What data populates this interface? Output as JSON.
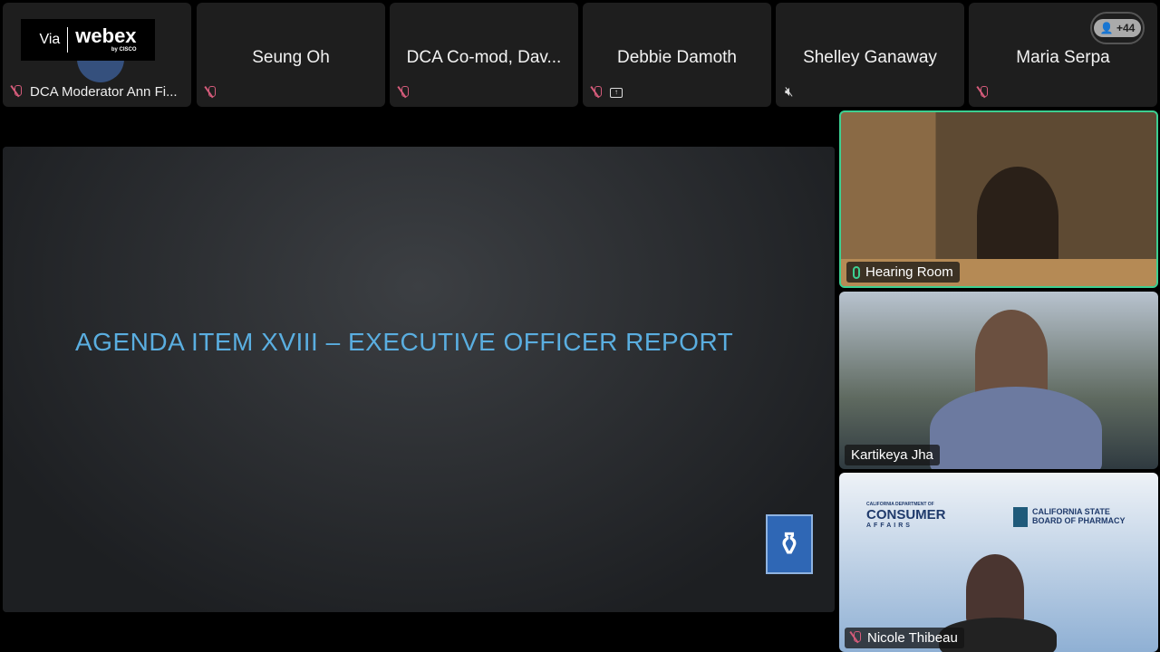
{
  "participants": [
    {
      "name": "DCA Moderator Ann Fi...",
      "muted": true
    },
    {
      "name": "Seung Oh",
      "muted": true
    },
    {
      "name": "DCA Co-mod, Dav...",
      "muted": true
    },
    {
      "name": "Debbie Damoth",
      "muted": true,
      "sharing": true
    },
    {
      "name": "Shelley Ganaway",
      "speaker_muted": true
    },
    {
      "name": "Maria Serpa",
      "muted": true
    }
  ],
  "webex": {
    "via": "Via",
    "brand": "webex",
    "by": "by CISCO"
  },
  "more_participants": "+44",
  "slide": {
    "title": "AGENDA ITEM XVIII – EXECUTIVE OFFICER REPORT"
  },
  "videos": [
    {
      "label": "Hearing Room",
      "active": true
    },
    {
      "label": "Kartikeya Jha"
    },
    {
      "label": "Nicole Thibeau",
      "muted": true
    }
  ],
  "logos": {
    "dca_small": "CALIFORNIA DEPARTMENT OF",
    "dca": "CONSUMER",
    "dca_sub": "AFFAIRS",
    "bop1": "CALIFORNIA STATE",
    "bop2": "BOARD OF PHARMACY"
  },
  "colors": {
    "active_border": "#3ccf91",
    "muted": "#d45b7a",
    "slide_title": "#5aaee0"
  }
}
